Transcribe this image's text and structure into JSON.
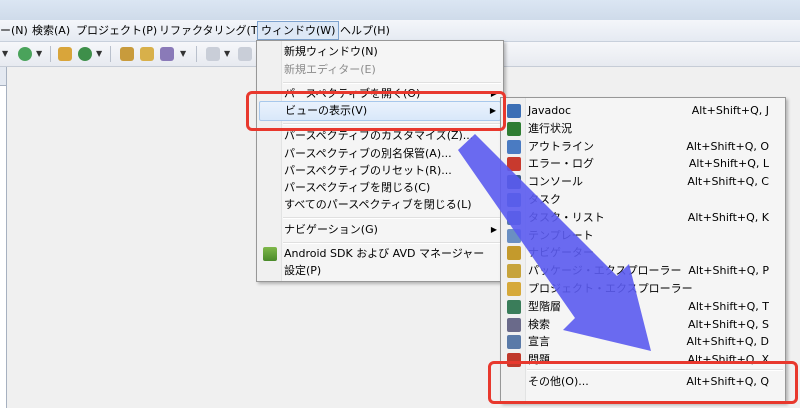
{
  "menubar": {
    "items": [
      "ー(N)",
      "検索(A)",
      "プロジェクト(P)",
      "リファクタリング(T)",
      "ウィンドウ(W)",
      "ヘルプ(H)"
    ]
  },
  "window_menu": {
    "items": [
      {
        "label": "新規ウィンドウ(N)",
        "disabled": false
      },
      {
        "label": "新規エディター(E)",
        "disabled": true
      },
      {
        "label": "パースペクティブを開く(O)",
        "submenu": true
      },
      {
        "label": "ビューの表示(V)",
        "submenu": true,
        "highlighted": true
      },
      {
        "label": "パースペクティブのカスタマイズ(Z)..."
      },
      {
        "label": "パースペクティブの別名保管(A)..."
      },
      {
        "label": "パースペクティブのリセット(R)..."
      },
      {
        "label": "パースペクティブを閉じる(C)"
      },
      {
        "label": "すべてのパースペクティブを閉じる(L)"
      },
      {
        "label": "ナビゲーション(G)",
        "submenu": true
      },
      {
        "label": "Android SDK および AVD マネージャー"
      },
      {
        "label": "設定(P)"
      }
    ]
  },
  "show_view_menu": {
    "items": [
      {
        "label": "Javadoc",
        "shortcut": "Alt+Shift+Q, J",
        "icon": "javadoc-icon",
        "color": "#3c6fb5"
      },
      {
        "label": "進行状況",
        "shortcut": "",
        "icon": "progress-icon",
        "color": "#2f7d32"
      },
      {
        "label": "アウトライン",
        "shortcut": "Alt+Shift+Q, O",
        "icon": "outline-icon",
        "color": "#4a7bc2"
      },
      {
        "label": "エラー・ログ",
        "shortcut": "Alt+Shift+Q, L",
        "icon": "error-log-icon",
        "color": "#c83a2e"
      },
      {
        "label": "コンソール",
        "shortcut": "Alt+Shift+Q, C",
        "icon": "console-icon",
        "color": "#3b5b8c"
      },
      {
        "label": "タスク",
        "shortcut": "",
        "icon": "task-icon",
        "color": "#4b7ab9"
      },
      {
        "label": "タスク・リスト",
        "shortcut": "Alt+Shift+Q, K",
        "icon": "task-list-icon",
        "color": "#5577a8"
      },
      {
        "label": "テンプレート",
        "shortcut": "",
        "icon": "template-icon",
        "color": "#6a8fc2"
      },
      {
        "label": "ナビゲーター",
        "shortcut": "",
        "icon": "navigator-icon",
        "color": "#c49a2c"
      },
      {
        "label": "パッケージ・エクスプローラー",
        "shortcut": "Alt+Shift+Q, P",
        "icon": "package-explorer-icon",
        "color": "#c7a43c"
      },
      {
        "label": "プロジェクト・エクスプローラー",
        "shortcut": "",
        "icon": "project-explorer-icon",
        "color": "#d6a93a"
      },
      {
        "label": "型階層",
        "shortcut": "Alt+Shift+Q, T",
        "icon": "type-hierarchy-icon",
        "color": "#3a7d5a"
      },
      {
        "label": "検索",
        "shortcut": "Alt+Shift+Q, S",
        "icon": "search-icon",
        "color": "#6a6a8a"
      },
      {
        "label": "宣言",
        "shortcut": "Alt+Shift+Q, D",
        "icon": "declaration-icon",
        "color": "#5a7aa8"
      },
      {
        "label": "問題",
        "shortcut": "Alt+Shift+Q, X",
        "icon": "problems-icon",
        "color": "#c0392b"
      }
    ],
    "other": {
      "label": "その他(O)...",
      "shortcut": "Alt+Shift+Q, Q"
    }
  },
  "colors": {
    "highlight_box": "#e8382d",
    "annotation_arrow": "#5b5bf0"
  }
}
